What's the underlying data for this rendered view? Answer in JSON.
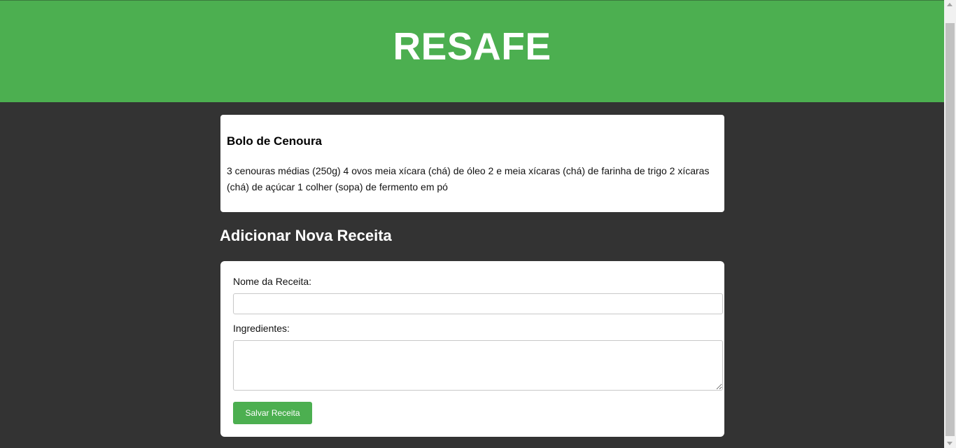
{
  "header": {
    "title": "RESAFE"
  },
  "recipes": [
    {
      "name": "Bolo de Cenoura",
      "ingredients": "3 cenouras médias (250g) 4 ovos meia xícara (chá) de óleo 2 e meia xícaras (chá) de farinha de trigo 2 xícaras (chá) de açúcar 1 colher (sopa) de fermento em pó"
    }
  ],
  "form": {
    "section_title": "Adicionar Nova Receita",
    "name_label": "Nome da Receita:",
    "name_value": "",
    "ingredients_label": "Ingredientes:",
    "ingredients_value": "",
    "submit_label": "Salvar Receita"
  },
  "colors": {
    "brand": "#4caf50",
    "background": "#333333",
    "card": "#ffffff"
  }
}
